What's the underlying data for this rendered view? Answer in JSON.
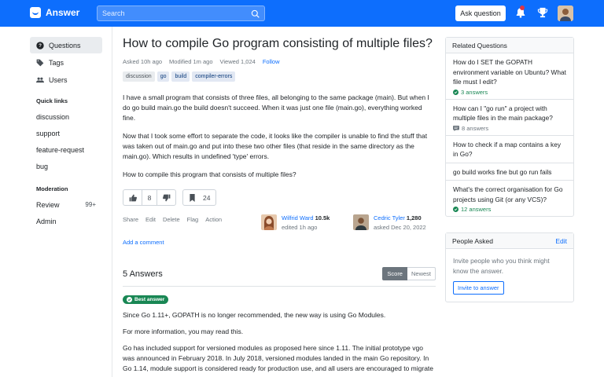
{
  "header": {
    "brand": "Answer",
    "search_placeholder": "Search",
    "ask_button": "Ask question",
    "accent": "#0d6efd"
  },
  "sidebar": {
    "nav": [
      {
        "label": "Questions",
        "icon": "question-circle-icon",
        "active": true
      },
      {
        "label": "Tags",
        "icon": "tag-icon"
      },
      {
        "label": "Users",
        "icon": "people-icon"
      }
    ],
    "quick_links_title": "Quick links",
    "quick_links": [
      "discussion",
      "support",
      "feature-request",
      "bug"
    ],
    "moderation_title": "Moderation",
    "moderation": [
      {
        "label": "Review",
        "count": "99+"
      },
      {
        "label": "Admin",
        "count": ""
      }
    ]
  },
  "question": {
    "title": "How to compile Go program consisting of multiple files?",
    "asked": "Asked 10h ago",
    "modified": "Modified 1m ago",
    "viewed": "Viewed 1,024",
    "follow": "Follow",
    "tags": [
      "discussion",
      "go",
      "build",
      "compiler-errors"
    ],
    "paragraphs": [
      "I have a small program that consists of three files, all belonging to the same package (main). But when I do go build main.go the build doesn't succeed. When it was just one file (main.go), everything worked fine.",
      "Now that I took some effort to separate the code, it looks like the compiler is unable to find the stuff that was taken out of main.go and put into these two other files (that reside in the same directory as the main.go). Which results in undefined 'type' errors.",
      "How to compile this program that consists of multiple files?"
    ],
    "votes": "8",
    "bookmarks": "24",
    "actions": [
      "Share",
      "Edit",
      "Delete",
      "Flag",
      "Action"
    ],
    "editor": {
      "name": "Wilfrid Ward",
      "rep": "10.5k",
      "sub": "edited 1h ago"
    },
    "author": {
      "name": "Cedric Tyler",
      "rep": "1,280",
      "sub": "asked Dec 20, 2022"
    },
    "add_comment": "Add a comment"
  },
  "answers": {
    "count_label": "5 Answers",
    "sort": [
      "Score",
      "Newest"
    ],
    "best_label": "Best answer",
    "paragraphs": [
      "Since Go 1.11+, GOPATH is no longer recommended, the new way is using Go Modules.",
      "For more information, you may read this.",
      "Go has included support for versioned modules as proposed here since 1.11. The initial prototype vgo was announced in February 2018. In July 2018, versioned modules landed in the main Go repository. In Go 1.14, module support is considered ready for production use, and all users are encouraged to migrate"
    ]
  },
  "related": {
    "title": "Related Questions",
    "items": [
      {
        "title": "How do I SET the GOPATH environment variable on Ubuntu? What file must I edit?",
        "answers": "3 answers",
        "accepted": true
      },
      {
        "title": "How can I \"go run\" a project with multiple files in the main package?",
        "answers": "8 answers",
        "accepted": false
      },
      {
        "title": "How to check if a map contains a key in Go?",
        "answers": "",
        "accepted": false
      },
      {
        "title": "go build works fine but go run fails",
        "answers": "",
        "accepted": false
      },
      {
        "title": "What's the correct organisation for Go projects using Git (or any VCS)?",
        "answers": "12 answers",
        "accepted": true
      }
    ]
  },
  "people_asked": {
    "title": "People Asked",
    "edit": "Edit",
    "text": "Invite people who you think might know the answer.",
    "button": "Invite to answer"
  }
}
